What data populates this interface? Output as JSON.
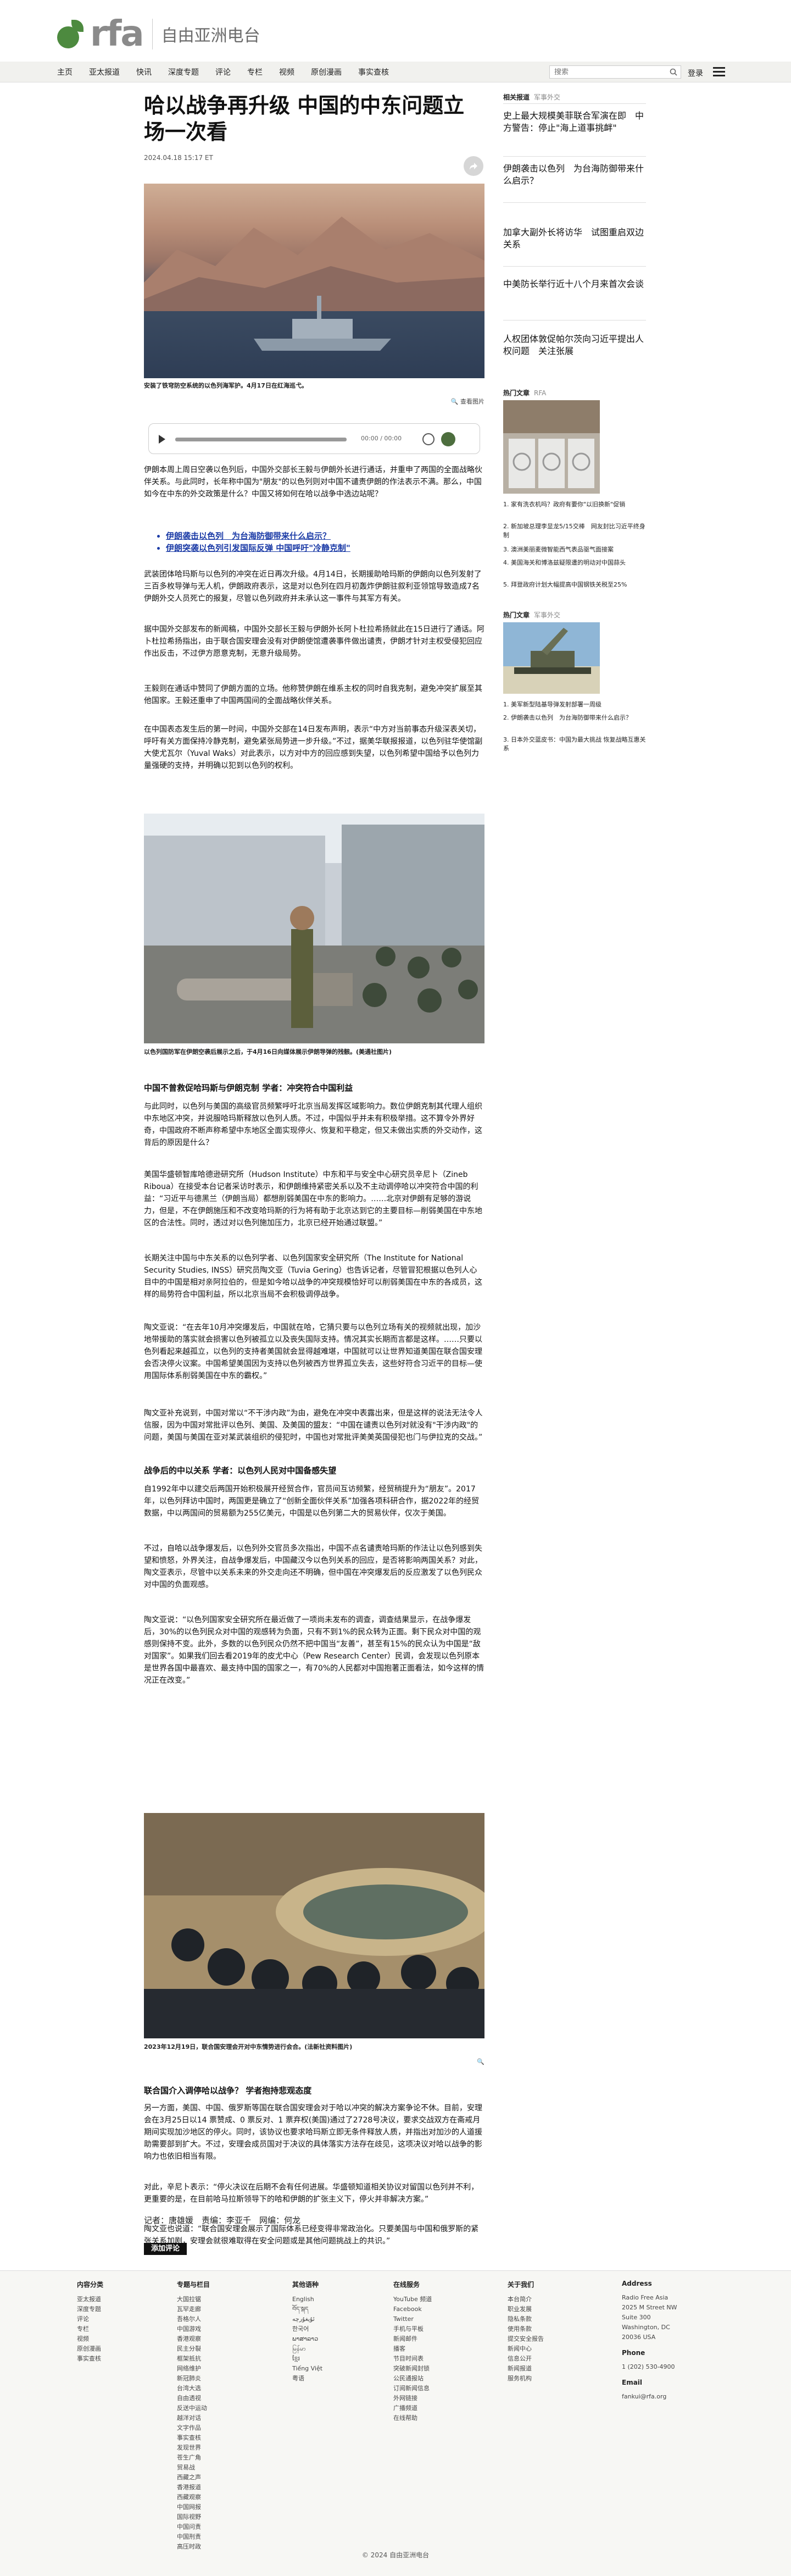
{
  "brand": {
    "logo": "rfa",
    "name_cn": "自由亚洲电台",
    "accent": "#4d8a3f"
  },
  "nav": {
    "items": [
      "主页",
      "亚太报道",
      "快讯",
      "深度专题",
      "评论",
      "专栏",
      "视频",
      "原创漫画",
      "事实查核"
    ],
    "search_placeholder": "搜索",
    "login": "登录"
  },
  "article": {
    "headline": "哈以战争再升级 中国的中东问题立场一次看",
    "timestamp": "2024.04.18 15:17 ET",
    "hero_caption": "安装了铁穹防空系统的以色列海军护。4月17日在红海巡弋。",
    "zoom_label": "查看图片",
    "audio": {
      "time": "00:00 / 00:00"
    },
    "paragraphs": [
      "伊朗本周上周日空袭以色列后，中国外交部长王毅与伊朗外长进行通话，并重申了两国的全面战略伙伴关系。与此同时，长年称中国为\"朋友\"的以色列则对中国不谴责伊朗的作法表示不满。那么，中国如今在中东的外交政策是什么？中国又将如何在哈以战争中选边站呢？"
    ],
    "links": [
      "伊朗袭击以色列　为台海防御带来什么启示？",
      "伊朗突袭以色列引发国际反弹 中国呼吁\"冷静克制\""
    ],
    "body1": [
      "武装团体哈玛斯与以色列的冲突在近日再次升级。4月14日，长期援助哈玛斯的伊朗向以色列发射了三百多枚导弹与无人机，伊朗政府表示，这是对以色列在四月初轰炸伊朗驻叙利亚领馆导致造成7名伊朗外交人员死亡的报复，尽管以色列政府并未承认这一事件与其军方有关。",
      "据中国外交部发布的新闻稿，中国外交部长王毅与伊朗外长阿卜杜拉希扬就此在15日进行了通话。阿卜杜拉希扬指出，由于联合国安理会没有对伊朗使馆遭袭事件做出谴责，伊朗才针对主权受侵犯回应作出反击，不过伊方愿意克制，无意升级局势。",
      "王毅则在通话中赞同了伊朗方面的立场。他称赞伊朗在维系主权的同时自我克制，避免冲突扩展至其他国家。王毅还重申了中国两国间的全面战略伙伴关系。",
      "在中国表态发生后的第一时间，中国外交部在14日发布声明，表示“中方对当前事态升级深表关切，呼吁有关方面保持冷静克制，避免紧张局势进一步升级。”不过，据美华联报报道，以色列驻华使馆副大使尤瓦尔（Yuval Waks）对此表示，以方对中方的回应感到失望，以色列希望中国给予以色列力量强硬的支持，并明确以犯到以色列的权利。"
    ],
    "photo2_caption": "以色列国防军在伊朗空袭后展示之后，于4月16日向媒体展示伊朗导弹的残骸。(美通社图片)",
    "subhead1": "中国不曾救促哈玛斯与伊朗克制 学者：冲突符合中国利益",
    "body2": [
      "与此同时，以色列与美国的高级官员频繁呼吁北京当局发挥区域影响力。数位伊朗克制其代理人组织中东地区冲突，并说服哈玛斯释放以色列人质。不过，中国似乎并未有积极举措。这不算令外界好奇，中国政府不断声称希望中东地区全面实现停火、恢复和平稳定，但又未做出实质的外交动作，这背后的原因是什么？",
      "美国华盛顿智库哈德逊研究所（Hudson Institute）中东和平与安全中心研究员辛尼卜（Zineb Riboua）在接受本台记者采访时表示，和伊朗维持紧密关系以及不主动调停哈以冲突符合中国的利益：“习近平与德黑兰（伊朗当局）都想削弱美国在中东的影响力。……北京对伊朗有足够的游说力，但是，不在伊朗施压和不改变哈玛斯的行为将有助于北京达到它的主要目标—削弱美国在中东地区的合法性。同时，透过对以色列施加压力，北京已经开始通过联盟。”",
      "长期关注中国与中东关系的以色列学者、以色列国家安全研究所（The Institute for National Security Studies, INSS）研究员陶文亚（Tuvia Gering）也告诉记者，尽管冒犯根据以色列人心目中的中国是相对亲阿拉伯的，但是如今哈以战争的冲突规模恰好可以削弱美国在中东的各成员，这样的局势符合中国利益，所以北京当局不会积极调停战争。",
      "陶文亚说：“在去年10月冲突爆发后，中国就在哈，它猜只要与以色列立场有关的视频就出现，加沙地带援助的落实就会损害以色列被孤立以及丧失国际支持。情况其实长期而言都是这样。……只要以色列看起来越孤立，以色列的支持者美国就会显得越难堪，中国就可以让世界知道美国在联合国安理会否决停火议案。中国希望美国因为支持以色列被西方世界孤立失去，这些好符合习近平的目标—使用国际体系削弱美国在中东的霸权。”",
      "陶文亚补充说到，中国对常以“不干涉内政”为由，避免在冲突中表露出来，但是这样的说法无法令人信服，因为中国对常批评以色列、美国、及美国的盟友：“中国在谴责以色列对就没有\"干涉内政\"的问题，美国与美国在亚对某武装组织的侵犯时，中国也对常批评美美英国侵犯也门与伊拉克的交战。”"
    ],
    "subhead2": "战争后的中以关系 学者：以色列人民对中国备感失望",
    "body3": [
      "自1992年中以建交后两国开始积极展开经贸合作，官员间互访频繁，经贸稍提升为“朋友”。2017年，以色列拜访中国时，两国更是确立了“创新全面伙伴关系”加强各项科研合作，据2022年的经贸数据，中以两国间的贸易额为255亿美元，中国是以色列第二大的贸易伙伴，仅次于美国。",
      "不过，自哈以战争爆发后，以色列外交官员多次指出，中国不点名谴责哈玛斯的作法让以色列感到失望和愤怒，外界关注，自战争爆发后，中国藏汉今以色列关系的回应，是否将影响两国关系？对此，陶文亚表示，尽管中以关系未来的外交走向还不明确，但中国在冲突爆发后的反应激发了以色列民众对中国的负面观感。",
      "陶文亚说：“以色列国家安全研究所在最近做了一项尚未发布的调查，调查结果显示，在战争爆发后，30%的以色列民众对中国的观感转为负面，只有不到1%的民众转为正面。剩下民众对中国的观感则保持不变。此外，多数的以色列民众仍然不把中国当“友善”，甚至有15%的民众认为中国是“敌对国家”。如果我们回去看2019年的皮尤中心（Pew Research Center）民调，会发现以色列原本是世界各国中最喜欢、最支持中国的国家之一，有70%的人民都对中国抱著正面看法，如今这样的情况正在改变。”"
    ],
    "photo3_caption": "2023年12月19日，联合国安理会开对中东情势进行会合。(法新社资料图片)",
    "subhead3": "联合国介入调停哈以战争？ 学者抱持悲观态度",
    "body4": [
      "另一方面，美国、中国、俄罗斯等国在联合国安理会对于哈以冲突的解决方案争论不休。目前，安理会在3月25日以14 票赞成、0 票反对、1 票弃权(美国)通过了2728号决议，要求交战双方在斋戒月期间实现加沙地区的停火。同时，该协议也要求哈玛斯立即无条件释放人质，并指出对加沙的人道援助需要部到扩大。不过，安理会成员国对于决议的具体落实方法存在歧见，这项决议对哈以战争的影响力也依旧相当有限。",
      "对此，辛尼卜表示：“停火决议在后期不会有任何进展。华盛顿知道相关协议对留国以色列并不利，更重要的是，在目前哈马拉斯领导下的哈和伊朗的扩张主义下，停火并非解决方案。”",
      "陶文亚也说道：“联合国安理会展示了国际体系已经变得非常政治化。只要美国与中国和俄罗斯的紧张关系加剧，安理会就很难取得在安全问题或是其他问题挑战上的共识。”"
    ],
    "byline": "记者：唐雄媛　责编：李亚千　网编：何龙",
    "comment_button": "添加评论"
  },
  "sidebar": {
    "related_heading": "相关报道",
    "related_tag": "军事外交",
    "related": [
      "史上最大规模美菲联合军演在即　中方警告：停止\"海上道事挑衅\"",
      "伊朗袭击以色列　为台海防御带来什么启示？",
      "加拿大副外长将访华　试图重启双边关系",
      "中美防长举行近十八个月来首次会谈",
      "人权团体敦促帕尔茨向习近平提出人权问题　关注张展"
    ],
    "hot1_heading": "热门文章",
    "hot1_tag": "RFA",
    "hot1": [
      "1. 家有洗衣机吗？政府有要你\"以旧换新\"促销",
      "2. 新加坡总理李显龙5/15交棒　网友封比习近平终身制",
      "3. 澳洲美丽麦微智能西气表品驱气面接案",
      "4. 美国海关和博洛兹疑限遭的明动对中国蒜头",
      "5. 拜登政府计划大幅提高中国钢铁关税至25%"
    ],
    "hot2_heading": "热门文章",
    "hot2_tag": "军事外交",
    "hot2": [
      "1. 美军新型陆基导弹发射部署一周级",
      "2. 伊朗袭击以色列　为台海防御带来什么启示？",
      "3. 日本外交蓝皮书：中国为最大挑战 恢复战略互惠关系"
    ]
  },
  "footer": {
    "cols": [
      {
        "title": "内容分类",
        "items": [
          "亚太报道",
          "深度专题",
          "评论",
          "专栏",
          "视频",
          "原创漫画",
          "事实查核"
        ]
      },
      {
        "title": "专题与栏目",
        "items": [
          "大国拉锯",
          "瓦罕走廊",
          "吾格尔人",
          "中国游戏",
          "香港观察",
          "民主分裂",
          "框架抵抗",
          "网络维护",
          "新冠肺炎",
          "台湾大选",
          "自由透视",
          "反送中运动",
          "越洋对话",
          "文字作品",
          "事实查核",
          "发现世界",
          "苍生广角",
          "贸易战",
          "西藏之声",
          "香港报道",
          "西藏观察",
          "中国网报",
          "国际视野",
          "中国问责",
          "中国刑责",
          "高压时政"
        ]
      },
      {
        "title": "其他语种",
        "items": [
          "English",
          "བོད་སྐད",
          "ئۇيغۇرچە",
          "한국어",
          "ພາສາລາວ",
          "မြန်မာ",
          "ខ្មែរ",
          "Tiếng Việt",
          "粤语"
        ]
      },
      {
        "title": "在线服务",
        "items": [
          "YouTube 频道",
          "Facebook",
          "Twitter",
          "手机与平板",
          "新闻邮件",
          "播客",
          "节目时间表",
          "突破新闻封锁",
          "公民通报站",
          "订阅新闻信息",
          "外网链接",
          "广播频道",
          "在线帮助"
        ]
      },
      {
        "title": "关于我们",
        "items": [
          "本台简介",
          "职业发展",
          "隐私条款",
          "使用条款",
          "提交安全报告",
          "新闻中心",
          "信息公开",
          "新闻报道",
          "服务机构"
        ]
      },
      {
        "title": "Address",
        "items": [
          "Radio Free Asia",
          "2025 M Street NW",
          "Suite 300",
          "Washington, DC",
          "20036 USA"
        ]
      }
    ],
    "phone_title": "Phone",
    "phone": "1 (202) 530-4900",
    "email_title": "Email",
    "email": "fankui@rfa.org",
    "copyright": "© 2024 自由亚洲电台"
  }
}
